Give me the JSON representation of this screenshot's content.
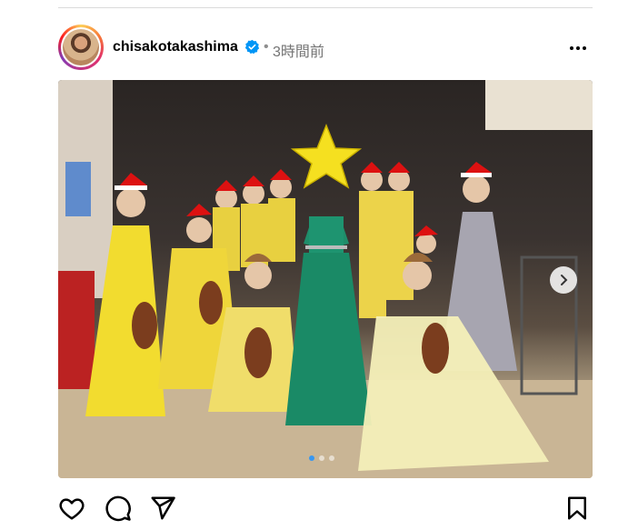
{
  "post": {
    "username": "chisakotakashima",
    "separator": "•",
    "timestamp": "3時間前"
  },
  "carousel": {
    "count": 3,
    "active_index": 0
  },
  "colors": {
    "verified": "#0095f6",
    "active_dot": "#3897f0"
  },
  "icons": {
    "verified": "verified-badge-icon",
    "more": "more-options-icon",
    "next": "chevron-right-icon",
    "like": "heart-icon",
    "comment": "comment-bubble-icon",
    "share": "paper-plane-icon",
    "save": "bookmark-icon"
  }
}
